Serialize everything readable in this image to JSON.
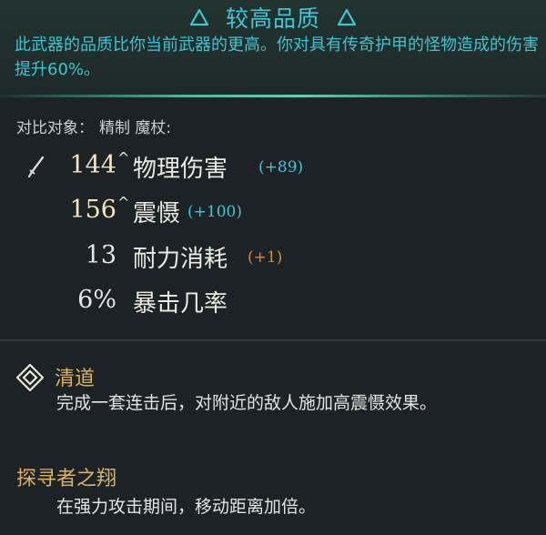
{
  "quality": {
    "title": "较高品质",
    "description": "此武器的品质比你当前武器的更高。你对具有传奇护甲的怪物造成的伤害提升60%。"
  },
  "compare": {
    "label": "对比对象：",
    "target": "精制 魔杖:"
  },
  "stats": [
    {
      "value": "144",
      "caret": "^",
      "name": "物理伤害",
      "delta": "(+89)",
      "delta_type": "increase",
      "icon": "sword-icon"
    },
    {
      "value": "156",
      "caret": "^",
      "name": "震慑",
      "delta": "(+100)",
      "delta_type": "increase"
    },
    {
      "value": "13",
      "name": "耐力消耗",
      "delta": "(+1)",
      "delta_type": "cost"
    },
    {
      "value": "6%",
      "name": "暴击几率"
    }
  ],
  "perks": [
    {
      "title": "清道",
      "description": "完成一套连击后，对附近的敌人施加高震慑效果。",
      "icon": "diamond-icon"
    },
    {
      "title": "探寻者之翔",
      "description": "在强力攻击期间，移动距离加倍。"
    }
  ],
  "colors": {
    "quality_text": "#3ec7d6",
    "perk_title": "#dcb35a",
    "delta_increase": "#3ec7d6",
    "delta_cost": "#d98a3a"
  }
}
